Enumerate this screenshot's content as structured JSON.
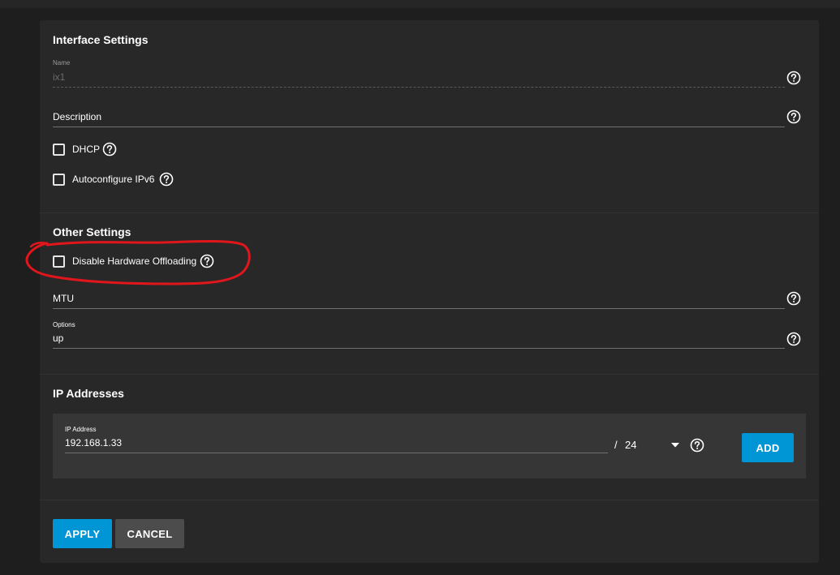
{
  "interface_settings": {
    "title": "Interface Settings",
    "name_label": "Name",
    "name_value": "ix1",
    "description_label": "Description",
    "dhcp_label": "DHCP",
    "autoconfig_label": "Autoconfigure IPv6"
  },
  "other_settings": {
    "title": "Other Settings",
    "disable_offloading_label": "Disable Hardware Offloading",
    "mtu_label": "MTU",
    "options_label": "Options",
    "options_value": "up"
  },
  "ip_addresses": {
    "title": "IP Addresses",
    "ip_label": "IP Address",
    "ip_value": "192.168.1.33",
    "slash": "/",
    "netmask_value": "24",
    "add_label": "ADD"
  },
  "actions": {
    "apply_label": "APPLY",
    "cancel_label": "CANCEL"
  },
  "colors": {
    "accent": "#0095d5",
    "annotation": "#e0161c"
  },
  "icons": {
    "help": "help-circle-icon",
    "dropdown": "caret-down-icon"
  }
}
